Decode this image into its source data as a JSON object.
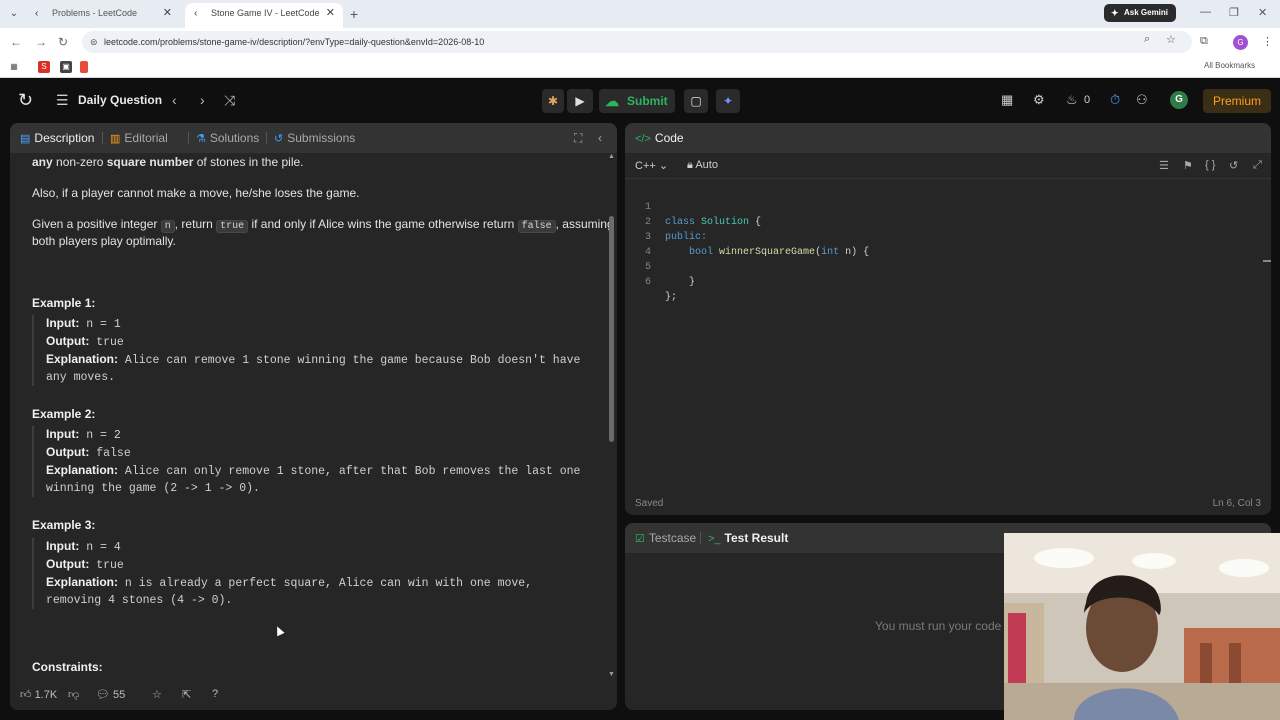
{
  "browser": {
    "tabs": [
      {
        "title": "Problems - LeetCode",
        "active": false
      },
      {
        "title": "Stone Game IV - LeetCode",
        "active": true
      }
    ],
    "new_tab": "+",
    "gemini_label": "Ask Gemini",
    "url": "leetcode.com/problems/stone-game-iv/description/?envType=daily-question&envId=2026-08-10",
    "profile_initial": "G",
    "all_bookmarks": "All Bookmarks"
  },
  "header": {
    "title": "Daily Question",
    "submit_label": "Submit",
    "streak_count": "0",
    "avatar_initial": "G",
    "premium_label": "Premium"
  },
  "description_panel": {
    "tabs": [
      {
        "label": "Description",
        "icon": "description-icon",
        "selected": true
      },
      {
        "label": "Editorial",
        "icon": "editorial-icon",
        "selected": false
      },
      {
        "label": "Solutions",
        "icon": "solutions-icon",
        "selected": false
      },
      {
        "label": "Submissions",
        "icon": "submissions-icon",
        "selected": false
      }
    ],
    "para1_bold_a": "any",
    "para1_mid": " non-zero ",
    "para1_bold_b": "square number",
    "para1_end": " of stones in the pile.",
    "para2": "Also, if a player cannot make a move, he/she loses the game.",
    "para3_a": "Given a positive integer ",
    "para3_code_n": "n",
    "para3_b": ", return ",
    "para3_code_true": "true",
    "para3_c": " if and only if Alice wins the game otherwise return ",
    "para3_code_false": "false",
    "para3_d": ", assuming",
    "para3_line2": "both players play optimally.",
    "examples": [
      {
        "title": "Example 1:",
        "input_label": "Input:",
        "input": " n = 1",
        "output_label": "Output:",
        "output": " true",
        "explanation_label": "Explanation:",
        "explanation_l1": " Alice can remove 1 stone winning the game because Bob doesn't have",
        "explanation_l2": "any moves."
      },
      {
        "title": "Example 2:",
        "input_label": "Input:",
        "input": " n = 2",
        "output_label": "Output:",
        "output": " false",
        "explanation_label": "Explanation:",
        "explanation_l1": " Alice can only remove 1 stone, after that Bob removes the last one",
        "explanation_l2": "winning the game (2 -> 1 -> 0)."
      },
      {
        "title": "Example 3:",
        "input_label": "Input:",
        "input": " n = 4",
        "output_label": "Output:",
        "output": " true",
        "explanation_label": "Explanation:",
        "explanation_l1": " n is already a perfect square, Alice can win with one move,",
        "explanation_l2": "removing 4 stones (4 -> 0)."
      }
    ],
    "constraints_title": "Constraints:",
    "footer": {
      "likes": "1.7K",
      "comments": "55"
    }
  },
  "code_panel": {
    "title": "Code",
    "language": "C++",
    "mode": "Auto",
    "lines": [
      {
        "n": "1",
        "text": "class Solution {"
      },
      {
        "n": "2",
        "text": "public:"
      },
      {
        "n": "3",
        "text": "    bool winnerSquareGame(int n) {"
      },
      {
        "n": "4",
        "text": "        "
      },
      {
        "n": "5",
        "text": "    }"
      },
      {
        "n": "6",
        "text": "};"
      }
    ],
    "status": "Saved",
    "cursor_position": "Ln 6, Col 3"
  },
  "result_panel": {
    "tab_testcase": "Testcase",
    "tab_result": "Test Result",
    "message": "You must run your code first"
  }
}
